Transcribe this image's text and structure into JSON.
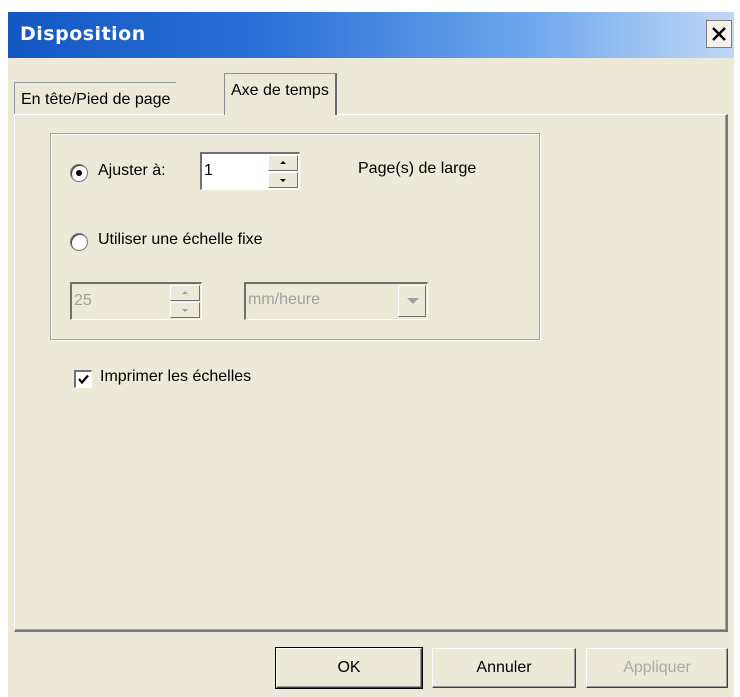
{
  "window": {
    "title": "Disposition",
    "close_icon": "close-icon"
  },
  "tabs": [
    {
      "label": "En tête/Pied de page",
      "selected": false
    },
    {
      "label": "Axe de temps",
      "selected": true
    }
  ],
  "fit_option": {
    "label": "Ajuster à:",
    "selected": true,
    "value": "1",
    "unit_label": "Page(s) de large"
  },
  "fixed_scale_option": {
    "label": "Utiliser une échelle fixe",
    "selected": false,
    "value": "25",
    "unit_select": "mm/heure",
    "enabled": false
  },
  "print_scales": {
    "label": "Imprimer les échelles",
    "checked": true
  },
  "buttons": {
    "ok": "OK",
    "cancel": "Annuler",
    "apply": "Appliquer"
  }
}
